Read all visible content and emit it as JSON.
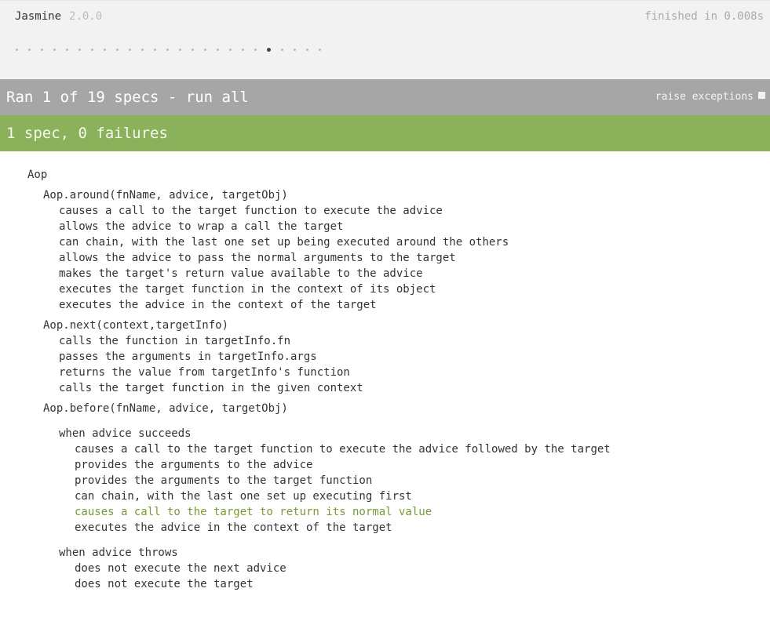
{
  "banner": {
    "name": "Jasmine",
    "version": "2.0.0",
    "duration": "finished in 0.008s",
    "symbols": [
      "disabled",
      "disabled",
      "disabled",
      "disabled",
      "disabled",
      "disabled",
      "disabled",
      "disabled",
      "disabled",
      "disabled",
      "disabled",
      "disabled",
      "disabled",
      "disabled",
      "disabled",
      "disabled",
      "disabled",
      "disabled",
      "disabled",
      "disabled",
      "passed",
      "disabled",
      "disabled",
      "disabled",
      "disabled"
    ]
  },
  "skipped_bar": {
    "text": "Ran 1 of 19 specs - run all",
    "raise_exceptions_label": "raise exceptions"
  },
  "status_bar": {
    "text": "1 spec, 0 failures"
  },
  "colors": {
    "skipped_bar": "#a6a6a6",
    "passed_bar": "#8bb25a",
    "highlighted_spec": "#7a9a34"
  },
  "suites": {
    "root": "Aop",
    "around": {
      "title": "Aop.around(fnName, advice, targetObj)",
      "specs": [
        "causes a call to the target function to execute the advice",
        "allows the advice to wrap a call the target",
        "can chain, with the last one set up being executed around the others",
        "allows the advice to pass the normal arguments to the target",
        "makes the target's return value available to the advice",
        "executes the target function in the context of its object",
        "executes the advice in the context of the target"
      ]
    },
    "next": {
      "title": "Aop.next(context,targetInfo)",
      "specs": [
        "calls the function in targetInfo.fn",
        "passes the arguments in targetInfo.args",
        "returns the value from targetInfo's function",
        "calls the target function in the given context"
      ]
    },
    "before": {
      "title": "Aop.before(fnName, advice, targetObj)",
      "succeeds": {
        "title": "when advice succeeds",
        "specs": [
          "causes a call to the target function to execute the advice followed by the target",
          "provides the arguments to the advice",
          "provides the arguments to the target function",
          "can chain, with the last one set up executing first",
          "causes a call to the target to return its normal value",
          "executes the advice in the context of the target"
        ]
      },
      "throws": {
        "title": "when advice throws",
        "specs": [
          "does not execute the next advice",
          "does not execute the target"
        ]
      }
    }
  }
}
